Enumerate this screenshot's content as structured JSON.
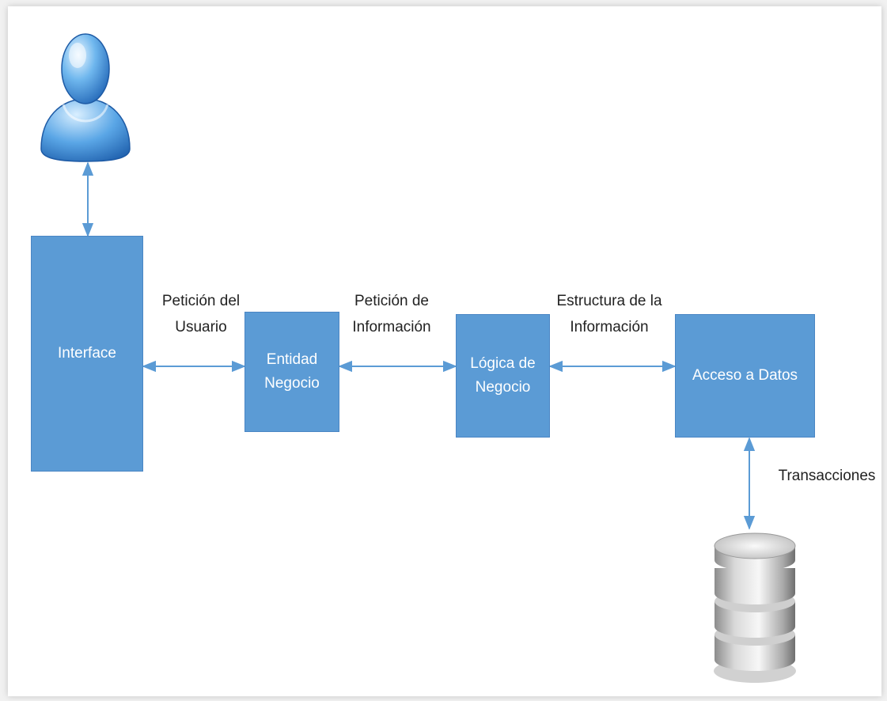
{
  "colors": {
    "block_fill": "#5b9bd5",
    "connector": "#5b9bd5",
    "label_text": "#222222",
    "block_text": "#ffffff"
  },
  "icons": {
    "user": "user-person-icon",
    "database": "database-cylinder-icon"
  },
  "blocks": {
    "interface": "Interface",
    "entidad_negocio": "Entidad\nNegocio",
    "logica_negocio": "Lógica de\nNegocio",
    "acceso_datos": "Acceso a Datos"
  },
  "labels": {
    "peticion_usuario": "Petición del\nUsuario",
    "peticion_informacion": "Petición de\nInformación",
    "estructura_informacion": "Estructura de la\nInformación",
    "transacciones": "Transacciones"
  }
}
